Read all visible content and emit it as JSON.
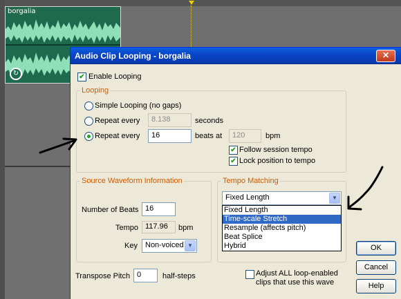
{
  "clip": {
    "name": "borgalia",
    "loop_icon": "loop-icon"
  },
  "dialog": {
    "title": "Audio Clip Looping - borgalia",
    "close_glyph": "✕",
    "enable_looping": {
      "label": "Enable Looping",
      "checked": true
    },
    "looping_group": {
      "title": "Looping",
      "simple": {
        "label": "Simple Looping (no gaps)",
        "selected": false
      },
      "repeat_seconds": {
        "label": "Repeat every",
        "value": "8.138",
        "unit": "seconds",
        "selected": false
      },
      "repeat_beats": {
        "label": "Repeat every",
        "value": "16",
        "beats_at_label": "beats at",
        "bpm_value": "120",
        "bpm_unit": "bpm",
        "selected": true
      },
      "follow_session_tempo": {
        "label": "Follow session tempo",
        "checked": true
      },
      "lock_position": {
        "label": "Lock position to tempo",
        "checked": true
      }
    },
    "source_group": {
      "title": "Source Waveform Information",
      "beats_label": "Number of Beats",
      "beats_value": "16",
      "tempo_label": "Tempo",
      "tempo_value": "117.96",
      "tempo_unit": "bpm",
      "key_label": "Key",
      "key_value": "Non-voiced"
    },
    "tempo_group": {
      "title": "Tempo Matching",
      "selected": "Fixed Length",
      "options": [
        "Fixed Length",
        "Time-scale Stretch",
        "Resample (affects pitch)",
        "Beat Splice",
        "Hybrid"
      ],
      "highlighted_index": 1
    },
    "transpose": {
      "label": "Transpose Pitch",
      "value": "0",
      "unit": "half-steps"
    },
    "adjust_all": {
      "line1": "Adjust ALL loop-enabled",
      "line2": "clips that use this wave",
      "checked": false
    },
    "buttons": {
      "ok": "OK",
      "cancel": "Cancel",
      "help": "Help"
    }
  }
}
